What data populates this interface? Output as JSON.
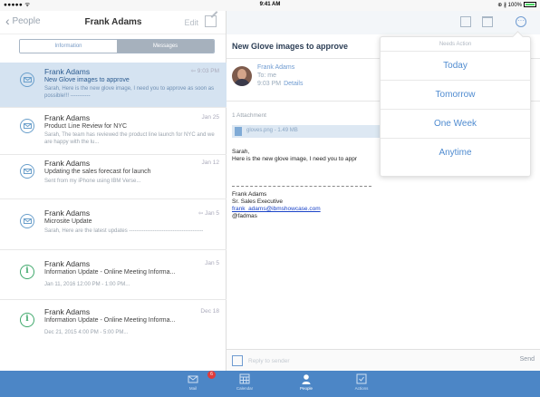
{
  "status_bar": {
    "signal": "●●●●● ᯤ",
    "time": "9:41 AM",
    "battery": "⊕ ∦ 100%"
  },
  "left_nav": {
    "back_label": "People",
    "title": "Frank Adams",
    "edit_label": "Edit"
  },
  "segments": [
    {
      "label": "Information",
      "active": true
    },
    {
      "label": "Messages",
      "active": false
    }
  ],
  "messages": [
    {
      "from": "Frank Adams",
      "date": "9:03 PM",
      "subject": "New Glove images to approve",
      "preview": "Sarah, Here is the new glove image, I need you to approve as soon as possible!!! -----------",
      "type": "mail",
      "selected": true
    },
    {
      "from": "Frank Adams",
      "date": "Jan 25",
      "subject": "Product Line Review for NYC",
      "preview": "Sarah, The team has reviewed the product line launch for NYC and we are happy with the lu...",
      "type": "mail",
      "selected": false
    },
    {
      "from": "Frank Adams",
      "date": "Jan 12",
      "subject": "Updating the sales forecast for launch",
      "preview": "Sent from my iPhone using IBM Verse...",
      "type": "mail",
      "selected": false
    },
    {
      "from": "Frank Adams",
      "date": "Jan 5",
      "subject": "Microsite Update",
      "preview": "Sarah, Here are the latest updates -----------------------------------------",
      "type": "mail",
      "selected": false
    },
    {
      "from": "Frank Adams",
      "date": "Jan 5",
      "subject": "Information Update - Online Meeting Informa...",
      "preview": "Jan 11, 2016 12:00 PM - 1:00 PM...",
      "type": "info",
      "selected": false
    },
    {
      "from": "Frank Adams",
      "date": "Dec 18",
      "subject": "Information Update - Online Meeting Informa...",
      "preview": "Dec 21, 2015 4:00 PM - 5:00 PM...",
      "type": "info",
      "selected": false
    }
  ],
  "message": {
    "subject": "New Glove images to approve",
    "sender": "Frank Adams",
    "to": "To: me",
    "time": "9:03 PM",
    "details_label": "Details",
    "attachments_count": "1 Attachment",
    "attachment_name": "gloves.png - 1.49 MB",
    "body_greeting": "Sarah,",
    "body_line": "Here is the new glove image, I need you to appr",
    "sig_name": "Frank Adams",
    "sig_title": "Sr. Sales Executive",
    "sig_email": "frank_adams@ibmshowcase.com",
    "sig_handle": "@fadmas"
  },
  "popover": {
    "title": "Needs Action",
    "options": [
      "Today",
      "Tomorrow",
      "One Week",
      "Anytime"
    ]
  },
  "reply": {
    "placeholder": "Reply to sender",
    "send_label": "Send"
  },
  "tabs": [
    {
      "label": "Mail",
      "badge": "6"
    },
    {
      "label": "Calendar"
    },
    {
      "label": "People"
    },
    {
      "label": "Actions"
    }
  ],
  "colors": {
    "accent": "#4f8bd0",
    "tabbar": "#4c86c6",
    "selected_row": "#d5e3f1",
    "badge": "#e03b3b"
  }
}
